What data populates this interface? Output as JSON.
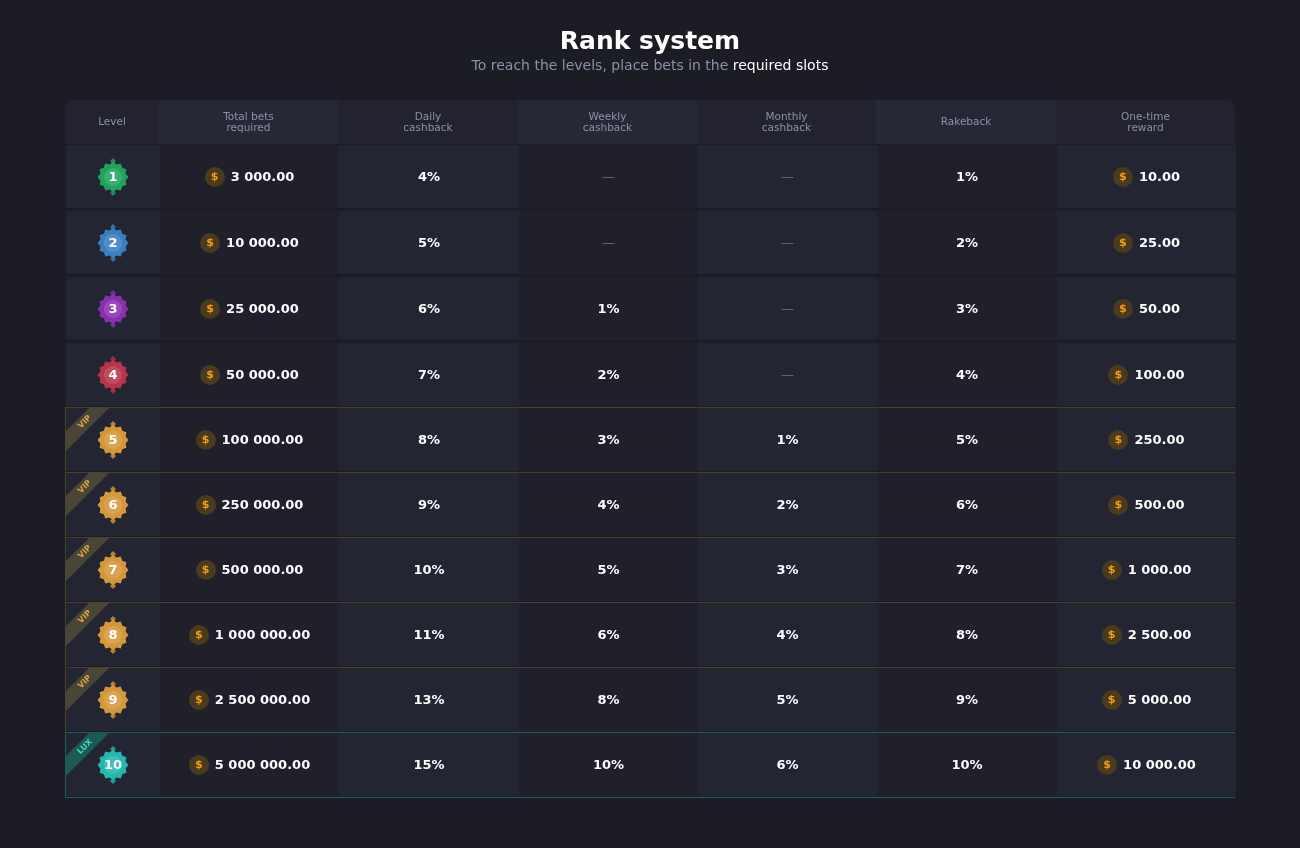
{
  "title": "Rank system",
  "subtitle": "To reach the levels, place bets in the **required slots**",
  "columns": [
    "Level",
    "Total bets\nrequired",
    "Daily\ncashback",
    "Weekly\ncashback",
    "Monthly\ncashback",
    "Rakeback",
    "One-time\nreward"
  ],
  "rows": [
    {
      "kind": "standard",
      "level": "1",
      "color": "#1fa35a",
      "bets": {
        "coin": "$",
        "amount": "3 000.00"
      },
      "daily": "4%",
      "weekly": "—",
      "monthly": "—",
      "rakeback": "1%",
      "reward": {
        "coin": "$",
        "amount": "10.00"
      }
    },
    {
      "kind": "standard",
      "level": "2",
      "color": "#3a7fc0",
      "bets": {
        "coin": "$",
        "amount": "10 000.00"
      },
      "daily": "5%",
      "weekly": "—",
      "monthly": "—",
      "rakeback": "2%",
      "reward": {
        "coin": "$",
        "amount": "25.00"
      }
    },
    {
      "kind": "standard",
      "level": "3",
      "color": "#8a2fb0",
      "bets": {
        "coin": "$",
        "amount": "25 000.00"
      },
      "daily": "6%",
      "weekly": "1%",
      "monthly": "—",
      "rakeback": "3%",
      "reward": {
        "coin": "$",
        "amount": "50.00"
      }
    },
    {
      "kind": "standard",
      "level": "4",
      "color": "#b8344a",
      "bets": {
        "coin": "$",
        "amount": "50 000.00"
      },
      "daily": "7%",
      "weekly": "2%",
      "monthly": "—",
      "rakeback": "4%",
      "reward": {
        "coin": "$",
        "amount": "100.00"
      }
    },
    {
      "kind": "vip",
      "tag": "VIP",
      "level": "5",
      "color": "#d4973a",
      "bets": {
        "coin": "$",
        "amount": "100 000.00"
      },
      "daily": "8%",
      "weekly": "3%",
      "monthly": "1%",
      "rakeback": "5%",
      "reward": {
        "coin": "$",
        "amount": "250.00"
      }
    },
    {
      "kind": "vip",
      "tag": "VIP",
      "level": "6",
      "color": "#d4973a",
      "bets": {
        "coin": "$",
        "amount": "250 000.00"
      },
      "daily": "9%",
      "weekly": "4%",
      "monthly": "2%",
      "rakeback": "6%",
      "reward": {
        "coin": "$",
        "amount": "500.00"
      }
    },
    {
      "kind": "vip",
      "tag": "VIP",
      "level": "7",
      "color": "#d4973a",
      "bets": {
        "coin": "$",
        "amount": "500 000.00"
      },
      "daily": "10%",
      "weekly": "5%",
      "monthly": "3%",
      "rakeback": "7%",
      "reward": {
        "coin": "$",
        "amount": "1 000.00"
      }
    },
    {
      "kind": "vip",
      "tag": "VIP",
      "level": "8",
      "color": "#d4973a",
      "bets": {
        "coin": "$",
        "amount": "1 000 000.00"
      },
      "daily": "11%",
      "weekly": "6%",
      "monthly": "4%",
      "rakeback": "8%",
      "reward": {
        "coin": "$",
        "amount": "2 500.00"
      }
    },
    {
      "kind": "vip",
      "tag": "VIP",
      "level": "9",
      "color": "#d4973a",
      "bets": {
        "coin": "$",
        "amount": "2 500 000.00"
      },
      "daily": "13%",
      "weekly": "8%",
      "monthly": "5%",
      "rakeback": "9%",
      "reward": {
        "coin": "$",
        "amount": "5 000.00"
      }
    },
    {
      "kind": "lux",
      "tag": "LUX",
      "level": "10",
      "color": "#22b8b0",
      "bets": {
        "coin": "$",
        "amount": "5 000 000.00"
      },
      "daily": "15%",
      "weekly": "10%",
      "monthly": "6%",
      "rakeback": "10%",
      "reward": {
        "coin": "$",
        "amount": "10 000.00"
      }
    }
  ]
}
